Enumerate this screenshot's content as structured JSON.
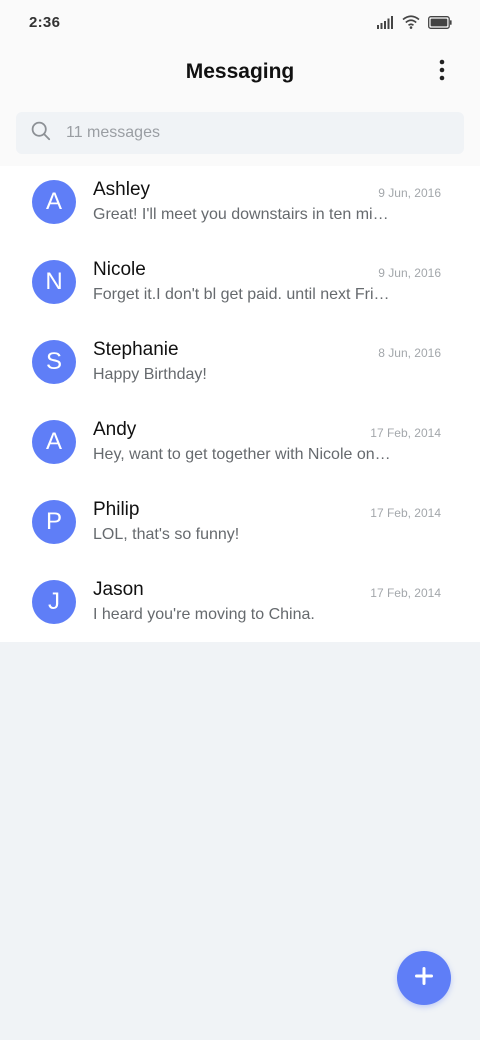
{
  "status_bar": {
    "time": "2:36",
    "icons": [
      "signal-icon",
      "wifi-icon",
      "battery-icon"
    ]
  },
  "header": {
    "title": "Messaging",
    "menu_icon": "more-vertical-icon"
  },
  "search": {
    "icon": "search-icon",
    "placeholder": "11 messages"
  },
  "conversations": [
    {
      "initial": "A",
      "name": "Ashley",
      "date": "9 Jun, 2016",
      "preview": "Great! I'll meet you downstairs in ten mi…"
    },
    {
      "initial": "N",
      "name": "Nicole",
      "date": "9 Jun, 2016",
      "preview": "Forget it.I don't bl get paid. until next Fri…"
    },
    {
      "initial": "S",
      "name": "Stephanie",
      "date": "8 Jun, 2016",
      "preview": "Happy Birthday!"
    },
    {
      "initial": "A",
      "name": "Andy",
      "date": "17 Feb, 2014",
      "preview": "Hey, want to get together with Nicole on …"
    },
    {
      "initial": "P",
      "name": "Philip",
      "date": "17 Feb, 2014",
      "preview": "LOL, that's so funny!"
    },
    {
      "initial": "J",
      "name": "Jason",
      "date": "17 Feb, 2014",
      "preview": "I heard you're moving to China."
    }
  ],
  "fab": {
    "icon": "plus-icon"
  },
  "colors": {
    "accent": "#5f7ef7",
    "background": "#f0f3f6",
    "header_background": "#fafafa"
  }
}
